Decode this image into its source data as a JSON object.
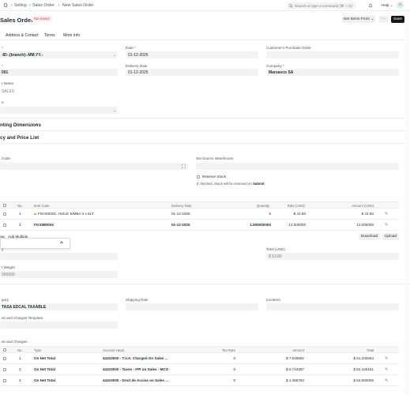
{
  "navbar": {
    "breadcrumbs": [
      "Selling",
      "Sales Order",
      "New Sales Order"
    ],
    "search_placeholder": "Search or type a command (⌘ + G)",
    "help_label": "Help",
    "avatar_initial": "A"
  },
  "header": {
    "title": "Sales Order",
    "status": "Not Saved",
    "get_items_label": "Get Items From",
    "more_label": "···",
    "save_label": "Save"
  },
  "tabs": [
    "Address & Contact",
    "Terms",
    "More Info"
  ],
  "form": {
    "series_label": "*",
    "series_value": "-ID-.{branch}-.MM.YY.-",
    "date_label": "Date",
    "date_value": "01-12-2025",
    "po_label": "Customer's Purchase Order",
    "customer_label": "*",
    "customer_value": "001",
    "delivery_label": "Delivery Date",
    "delivery_value": "01-12-2025",
    "company_label": "Company",
    "company_value": "Marsavco SA",
    "name_label": "r Name",
    "name_value": "SALES",
    "type_label": "e",
    "accounting_dimensions": "nting Dimensions",
    "currency_price_list": "cy and Price List",
    "scan_label": "Code",
    "source_warehouse_label": "Set Source Warehouse",
    "reserve_stock_label": "Reserve Stock",
    "reserve_stock_hint_prefix": "If checked, Stock will be reserved on ",
    "reserve_stock_hint_bold": "Submit"
  },
  "items_table": {
    "headers": [
      "No.",
      "Item Code",
      "Delivery Date",
      "Quantity",
      "Rate (USD)",
      "Amount (USD)"
    ],
    "rows": [
      {
        "no": "1",
        "item": "FGHS0001: HUILE SIMBA 4 x 5LT",
        "date": "01-12-2025",
        "qty": "5",
        "rate": "$ 41.80",
        "amount": "$ 41.80"
      },
      {
        "no": "2",
        "item": "FGSIM0004",
        "date": "01-12-2025",
        "qty": "1.000000000",
        "rate": "12.000000",
        "amount": "12.000000"
      }
    ],
    "add_row_label": "ow",
    "add_multiple_label": "Add Multiple",
    "download_label": "Download",
    "upload_label": "Upload"
  },
  "totals": {
    "qty_label": "y",
    "total_label": "Total (USD)",
    "total_value": "$ 53.80",
    "weight_label": "t Weight",
    "weight_value": "000000"
  },
  "taxes": {
    "category_label": "gory",
    "category_value": "TASA EDCAL TAXABLE",
    "shipping_label": "Shipping Rule",
    "incoterm_label": "Incoterm",
    "template_label": "es and Charges Template",
    "charges_label": "es and Charges",
    "headers": [
      "No.",
      "Type",
      "Account Head",
      "Tax Rate",
      "Amount",
      "Total"
    ],
    "rows": [
      {
        "no": "1",
        "type": "On Net Total",
        "account": "44310000 - T.V.A. Charged On Sales ...",
        "rate": "0",
        "amount": "$ 7.530692",
        "total": "$ 51.330664"
      },
      {
        "no": "2",
        "type": "On Net Total",
        "account": "44310000 - Taxes - FPI on Sales - MCO",
        "rate": "0",
        "amount": "$ 0.744287",
        "total": "$ 52.445151"
      },
      {
        "no": "3",
        "type": "On Net Total",
        "account": "44310000 - Droit de Accise on Sales ...",
        "rate": "0",
        "amount": "$ 1.356763",
        "total": "$ 53.800005"
      }
    ]
  }
}
